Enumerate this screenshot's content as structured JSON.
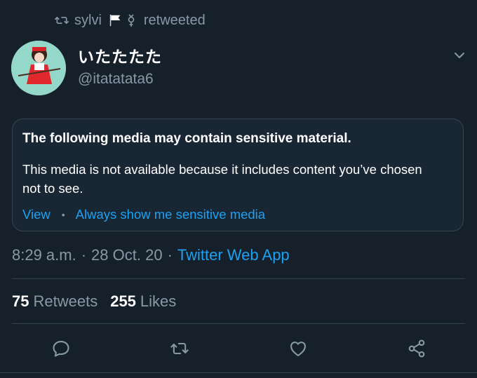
{
  "retweet_context": {
    "icon": "retweet-icon",
    "user": "sylvi",
    "text": "retweeted"
  },
  "author": {
    "display_name": "いたたたた",
    "handle": "@itatatata6"
  },
  "sensitive_notice": {
    "title": "The following media may contain sensitive material.",
    "body": "This media is not available because it includes content you’ve chosen not to see.",
    "view_label": "View",
    "separator": "•",
    "always_show_label": "Always show me sensitive media"
  },
  "meta": {
    "time": "8:29 a.m.",
    "date": "28 Oct. 20",
    "separator": "·",
    "source": "Twitter Web App"
  },
  "stats": {
    "retweets_count": "75",
    "retweets_label": "Retweets",
    "likes_count": "255",
    "likes_label": "Likes"
  },
  "actions": [
    "reply-icon",
    "retweet-icon",
    "like-icon",
    "share-icon"
  ],
  "colors": {
    "background": "#15202b",
    "card": "#192734",
    "border": "#38444d",
    "secondary_text": "#8899a6",
    "accent": "#1da1f2"
  }
}
